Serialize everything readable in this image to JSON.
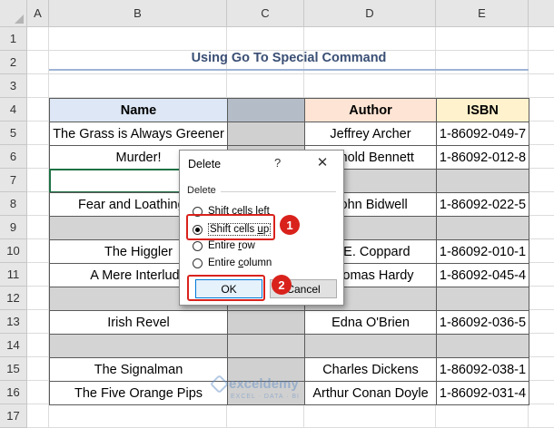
{
  "columns": [
    "A",
    "B",
    "C",
    "D",
    "E"
  ],
  "rows": [
    "1",
    "2",
    "3",
    "4",
    "5",
    "6",
    "7",
    "8",
    "9",
    "10",
    "11",
    "12",
    "13",
    "14",
    "15",
    "16",
    "17"
  ],
  "title": "Using Go To Special Command",
  "table": {
    "headers": {
      "name": "Name",
      "author": "Author",
      "isbn": "ISBN"
    },
    "rows": [
      {
        "name": "The Grass is Always Greener",
        "author": "Jeffrey Archer",
        "isbn": "1-86092-049-7"
      },
      {
        "name": "Murder!",
        "author": "Arnold Bennett",
        "isbn": "1-86092-012-8"
      },
      {
        "name": "",
        "author": "",
        "isbn": ""
      },
      {
        "name": "Fear and Loathing in",
        "author": "John Bidwell",
        "isbn": "1-86092-022-5"
      },
      {
        "name": "",
        "author": "",
        "isbn": ""
      },
      {
        "name": "The Higgler",
        "author": "A.E. Coppard",
        "isbn": "1-86092-010-1"
      },
      {
        "name": "A Mere Interlude",
        "author": "Thomas Hardy",
        "isbn": "1-86092-045-4"
      },
      {
        "name": "",
        "author": "",
        "isbn": ""
      },
      {
        "name": "Irish Revel",
        "author": "Edna O'Brien",
        "isbn": "1-86092-036-5"
      },
      {
        "name": "",
        "author": "",
        "isbn": ""
      },
      {
        "name": "The Signalman",
        "author": "Charles Dickens",
        "isbn": "1-86092-038-1"
      },
      {
        "name": "The Five Orange Pips",
        "author": "Arthur Conan Doyle",
        "isbn": "1-86092-031-4"
      }
    ]
  },
  "dialog": {
    "title": "Delete",
    "help": "?",
    "close": "✕",
    "group_label": "Delete",
    "options": [
      {
        "pre": "Shift cells ",
        "key": "l",
        "post": "eft",
        "selected": false
      },
      {
        "pre": "Shift cells ",
        "key": "u",
        "post": "p",
        "selected": true
      },
      {
        "pre": "Entire ",
        "key": "r",
        "post": "ow",
        "selected": false
      },
      {
        "pre": "Entire ",
        "key": "c",
        "post": "olumn",
        "selected": false
      }
    ],
    "ok_label": "OK",
    "cancel_label": "Cancel"
  },
  "annotations": {
    "step1": "1",
    "step2": "2"
  },
  "watermark": {
    "name": "exceldemy",
    "tagline": "EXCEL · DATA · BI"
  },
  "colors": {
    "highlight": "#d9221c",
    "title": "#3a4f75",
    "blank_row": "#d4d4d4"
  }
}
